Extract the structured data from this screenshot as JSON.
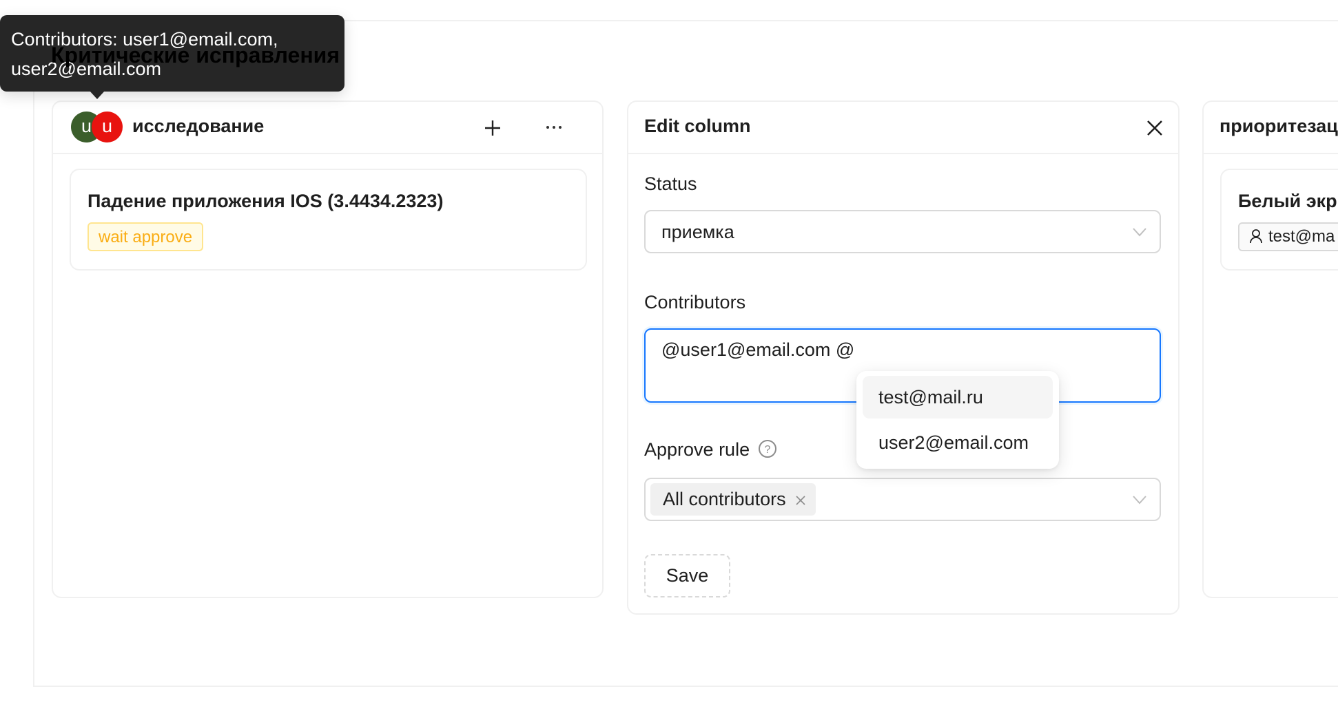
{
  "board": {
    "title": "Критические исправления"
  },
  "tooltip": {
    "text_line1": "Contributors: user1@email.com,",
    "text_line2": "user2@email.com"
  },
  "columns": [
    {
      "title": "исследование",
      "avatars": [
        {
          "letter": "u",
          "color": "#3b5e2b"
        },
        {
          "letter": "u",
          "color": "#e8130f"
        }
      ],
      "add_icon": "plus-icon",
      "more_icon": "ellipsis-icon",
      "cards": [
        {
          "title": "Падение приложения IOS (3.4434.2323)",
          "tag": "wait approve"
        }
      ]
    },
    {
      "title": "приоритезац",
      "cards": [
        {
          "title": "Белый экр",
          "assignee": "test@ma",
          "assignee_icon": "user-icon"
        }
      ]
    }
  ],
  "edit_panel": {
    "title": "Edit column",
    "close_icon": "close-icon",
    "status_label": "Status",
    "status_value": "приемка",
    "contributors_label": "Contributors",
    "contributors_value": "@user1@email.com @",
    "suggestions": [
      "test@mail.ru",
      "user2@email.com"
    ],
    "approve_rule_label": "Approve rule",
    "approve_rule_help_icon": "question-circle-icon",
    "approve_rule_tags": [
      "All contributors"
    ],
    "save_label": "Save"
  },
  "colors": {
    "accent": "#1677ff",
    "warning": "#faad14",
    "tooltip_bg": "#262626"
  }
}
